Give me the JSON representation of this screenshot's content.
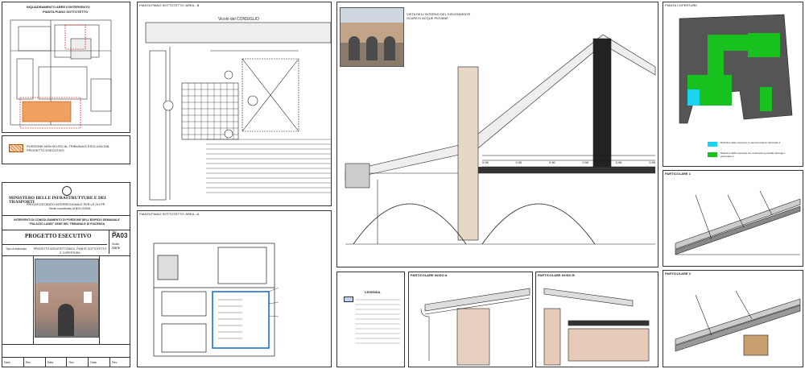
{
  "inquadramento": {
    "title": "INQUADRAMENTO AREE D'INTERVENTO",
    "subtitle": "PIANTA PIANO SOTTOTETTO",
    "legend_text": "PORZIONE NON IN USO AL TRIBUNALE ESCLUSA DAL PROGETTO ESECUTIVO"
  },
  "title_block": {
    "ministry": "MINISTERO DELLE INFRASTRUTTURE E DEI TRASPORTI",
    "office": "PROVVEDITORATO INTERREGIONALE PER LE OO.PP.",
    "seat": "Sede coordinata di BOLOGNA",
    "intervention": "INTERVENTI DI CONSOLIDAMENTO DI PORZIONE DELL'EDIFICIO DEMANIALE \"PALAZZO LANDI\" SEDE DEL TRIBUNALE DI PIACENZA",
    "phase": "PROGETTO ESECUTIVO",
    "table_label": "Tav.",
    "table_code": "PA03",
    "scale_label": "Scala",
    "scale_value": "Varie",
    "subject_label": "Tipo di elaborato",
    "subject": "PROGETTO ARCHITETTONICO, PIANTE SOTTOTETTO E COPERTURA",
    "footer_labels": [
      "Data",
      "Rev",
      "Data",
      "Rev",
      "Data",
      "Rev"
    ]
  },
  "panels": {
    "pianta_b": "PIANTA PIANO SOTTOTETTO: AREA - B",
    "vicolo": "Vicolo del CONSIGLIO",
    "pianta_a": "PIANTA PIANO SOTTOTETTO: AREA - A",
    "pianta_copertura": "PIANTA COPERTURE",
    "particolare_nodo_a": "PARTICOLARE NODO A",
    "particolare_nodo_b": "PARTICOLARE NODO B",
    "particolare_1": "PARTICOLARE 1",
    "particolare_2": "PARTICOLARE 2",
    "legenda": "LEGENDA",
    "photo_caption": "VISTA DELL'INTERNO DEL DISCENDENTE SCARICO ACQUE PIOVANE",
    "section_dims": [
      "0,96",
      "0,96",
      "0,96",
      "0,96",
      "0,96",
      "0,95"
    ],
    "copertura_legend": [
      "Ripristino delle coperture in elementi laterizi particolari 1",
      "Ripristino della copertura con sostituzione parziale del legno: particolare 2"
    ]
  },
  "colors": {
    "highlight_orange": "#f0a060",
    "roof_green": "#17c11e",
    "roof_cyan": "#1ad3f0",
    "roof_dark": "#555555",
    "blue_stair": "#1f6fd1"
  }
}
